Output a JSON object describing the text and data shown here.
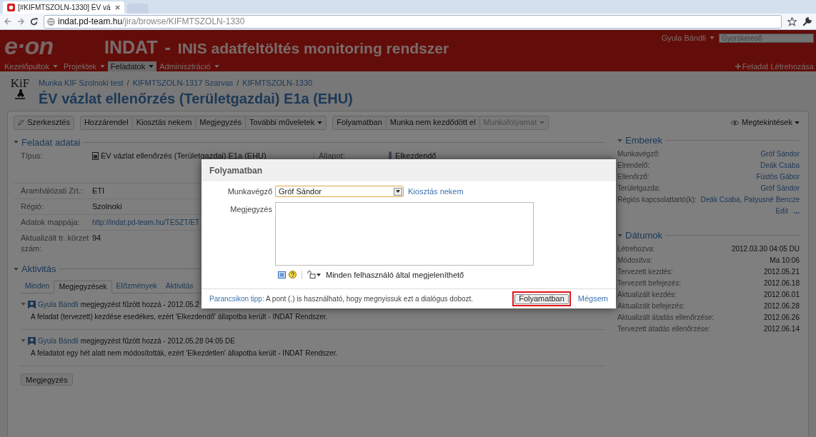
{
  "browser": {
    "tab_title": "[#KIFMTSZOLN-1330] ÉV vá",
    "url_host": "indat.pd-team.hu",
    "url_path": "/jira/browse/KIFMTSZOLN-1330"
  },
  "header": {
    "logo": "e·on",
    "app_name": "INDAT",
    "separator": "-",
    "subtitle": "INIS adatfeltöltés monitoring rendszer",
    "user": "Gyula Bándli",
    "search_placeholder": "Gyorskereső"
  },
  "nav": [
    {
      "label": "Kezelőpultok",
      "selected": false
    },
    {
      "label": "Projektek",
      "selected": false
    },
    {
      "label": "Feladatok",
      "selected": true
    },
    {
      "label": "Adminisztráció",
      "selected": false
    }
  ],
  "create_link": "Feladat Létrehozása",
  "breadcrumbs": [
    "Munka KIF Szolnoki test",
    "KIFMTSZOLN-1317 Szarvas",
    "KIFMTSZOLN-1330"
  ],
  "breadcrumb_separator": "/",
  "project_logo": "KiF",
  "issue_title": "ÉV vázlat ellenőrzés (Területgazdai) E1a (EHU)",
  "toolbar": [
    {
      "group": [
        {
          "label": "Szerkesztés",
          "kind": "edit",
          "disabled": false
        }
      ]
    },
    {
      "group": [
        {
          "label": "Hozzárendel",
          "kind": "plain",
          "disabled": false
        },
        {
          "label": "Kiosztás nekem",
          "kind": "plain",
          "disabled": false
        },
        {
          "label": "Megjegyzés",
          "kind": "plain",
          "disabled": false
        },
        {
          "label": "További műveletek",
          "kind": "dropdown",
          "disabled": false
        }
      ]
    },
    {
      "group": [
        {
          "label": "Folyamatban",
          "kind": "plain",
          "disabled": false
        },
        {
          "label": "Munka nem kezdődött el",
          "kind": "plain",
          "disabled": false
        },
        {
          "label": "Munkafolyamat",
          "kind": "dropdown",
          "disabled": true
        }
      ]
    }
  ],
  "views_button": "Megtekintések",
  "details": {
    "title": "Feladat adatai",
    "type_label": "Típus:",
    "type_value": "ÉV vázlat ellenőrzés (Területgazdai) E1a (EHU)",
    "status_label": "Állapot:",
    "status_value": "Elkezdendő",
    "fields": [
      {
        "label": "Áramhálózati Zrt.:",
        "value": "ETI",
        "kind": "text"
      },
      {
        "label": "Régió:",
        "value": "Szolnoki",
        "kind": "text"
      },
      {
        "label": "Adatok mappája:",
        "value": "http://indat.pd-team.hu/TESZT/ET",
        "kind": "link"
      },
      {
        "label": "Aktualizált tr. körzet szám:",
        "value": "94",
        "kind": "text"
      }
    ]
  },
  "activity": {
    "title": "Aktivitás",
    "tabs": [
      {
        "label": "Minden",
        "selected": false
      },
      {
        "label": "Megjegyzések",
        "selected": true
      },
      {
        "label": "Előzmények",
        "selected": false
      },
      {
        "label": "Aktivitás",
        "selected": false
      }
    ],
    "comments": [
      {
        "author": "Gyula Bándli",
        "action": "megjegyzést fűzött hozzá - 2012.05.2",
        "body": "A feladat (tervezett) kezdése esedékes, ezért 'Elkezdendő' állapotba került - INDAT Rendszer."
      },
      {
        "author": "Gyula Bándli",
        "action": "megjegyzést fűzött hozzá - 2012.05.28 04:05 DE",
        "body": "A feladatot egy hét alatt nem módosították, ezért 'Elkezdetlen' állapotba került - INDAT Rendszer."
      }
    ],
    "comment_button": "Megjegyzés"
  },
  "people": {
    "title": "Emberek",
    "rows": [
      {
        "label": "Munkavégző:",
        "value": "Gróf Sándor"
      },
      {
        "label": "Elrendelő:",
        "value": "Deák Csaba"
      },
      {
        "label": "Ellenőrző:",
        "value": "Füstös Gábor"
      },
      {
        "label": "Területgazda:",
        "value": "Gróf Sándor"
      },
      {
        "label": "Régiós kapcsolattartó(k):",
        "value": "Deák Csaba, Patyusné Bencze"
      }
    ],
    "edit": "Edit",
    "more": "..."
  },
  "dates": {
    "title": "Dátumok",
    "rows": [
      {
        "label": "Létrehozva:",
        "value": "2012.03.30 04:05 DU"
      },
      {
        "label": "Módosítva:",
        "value": "Ma 10:06"
      },
      {
        "label": "Tervezett kezdés:",
        "value": "2012.05.21"
      },
      {
        "label": "Tervezett befejezés:",
        "value": "2012.06.18"
      },
      {
        "label": "Aktualizált kezdés:",
        "value": "2012.06.01"
      },
      {
        "label": "Aktualizált befejezés:",
        "value": "2012.06.28"
      },
      {
        "label": "Aktualizált átadás ellenőrzése:",
        "value": "2012.06.26"
      },
      {
        "label": "Tervezett átadás ellenőrzése:",
        "value": "2012.06.14"
      }
    ]
  },
  "dialog": {
    "title": "Folyamatban",
    "assignee_label": "Munkavégző",
    "assignee_value": "Gróf Sándor",
    "assign_me": "Kiosztás nekem",
    "comment_label": "Megjegyzés",
    "visibility": "Minden felhasználó által megjeleníthető",
    "tip_label": "Parancsikon tipp:",
    "tip_text": "A pont (.) is használható, hogy megnyissuk ezt a dialógus dobozt.",
    "submit": "Folyamatban",
    "cancel": "Mégsem"
  }
}
